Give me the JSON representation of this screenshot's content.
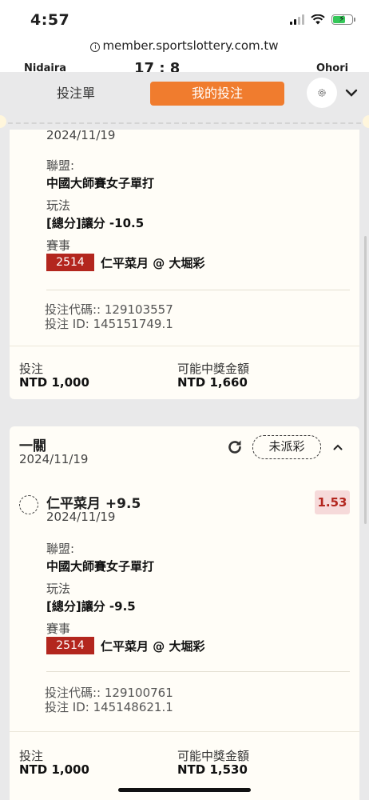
{
  "status_bar": {
    "time": "4:57"
  },
  "browser": {
    "url": "member.sportslottery.com.tw"
  },
  "score_strip": {
    "left_team": "Nidaira",
    "score": "17 : 8",
    "right_team": "Ohori"
  },
  "tabs": {
    "ticket": "投注單",
    "my_bets": "我的投注"
  },
  "colors": {
    "accent": "#f07c2e",
    "event_code_bg": "#b3261e",
    "odds_bg": "#f6dada",
    "odds_text": "#b3261e",
    "card_bg": "#fffdf7"
  },
  "bet1": {
    "date": "2024/11/19",
    "league_label": "聯盟:",
    "league": "中國大師賽女子單打",
    "play_label": "玩法",
    "play": "[總分]讓分 -10.5",
    "event_label": "賽事",
    "event_code": "2514",
    "event_name": "仁平菜月 @ 大堀彩",
    "bet_code": "投注代碼:: 129103557",
    "bet_id": "投注 ID: 145151749.1",
    "stake_label": "投注",
    "stake": "NTD 1,000",
    "payout_label": "可能中獎金額",
    "payout": "NTD 1,660"
  },
  "bet2": {
    "title": "一關",
    "date": "2024/11/19",
    "status": "未派彩",
    "selection": "仁平菜月 +9.5",
    "selection_date": "2024/11/19",
    "odds": "1.53",
    "league_label": "聯盟:",
    "league": "中國大師賽女子單打",
    "play_label": "玩法",
    "play": "[總分]讓分 -9.5",
    "event_label": "賽事",
    "event_code": "2514",
    "event_name": "仁平菜月 @ 大堀彩",
    "bet_code": "投注代碼:: 129100761",
    "bet_id": "投注 ID: 145148621.1",
    "stake_label": "投注",
    "stake": "NTD 1,000",
    "payout_label": "可能中獎金額",
    "payout": "NTD 1,530"
  }
}
